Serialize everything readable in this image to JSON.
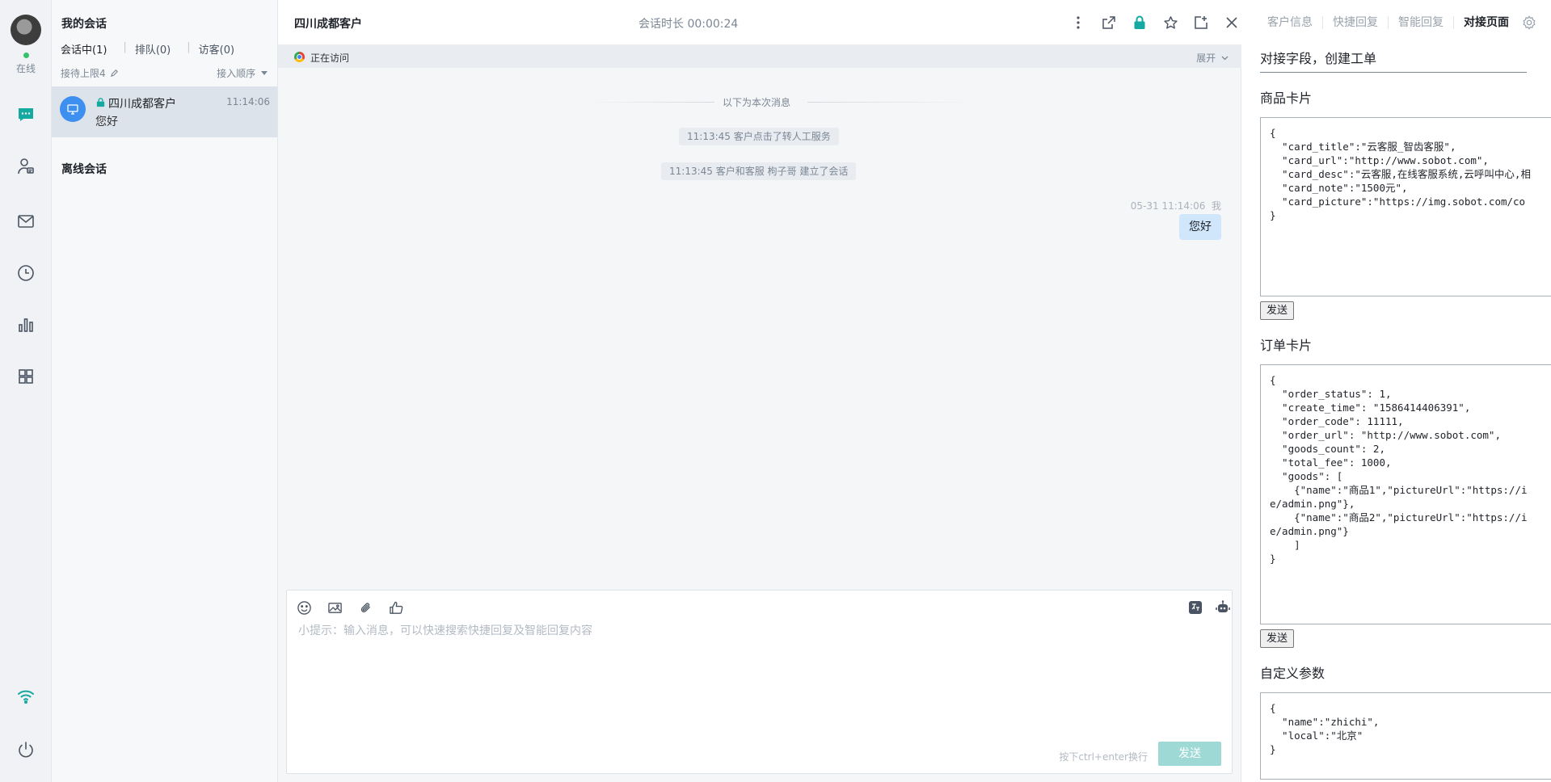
{
  "sidebar": {
    "status": "在线",
    "status_color": "#35c26b",
    "nav_icons": [
      "chat-icon",
      "visitor-icon",
      "mail-icon",
      "history-icon",
      "stats-icon",
      "apps-icon",
      "wifi-icon",
      "power-icon"
    ],
    "accent": "#14a9a1"
  },
  "conversations": {
    "title": "我的会话",
    "tabs": [
      {
        "label": "会话中(1)"
      },
      {
        "label": "排队(0)"
      },
      {
        "label": "访客(0)"
      }
    ],
    "limit": "接待上限4",
    "order": "接入顺序",
    "items": [
      {
        "name": "四川成都客户",
        "time": "11:14:06",
        "last_message": "您好"
      }
    ],
    "offline_title": "离线会话"
  },
  "chat": {
    "title": "四川成都客户",
    "duration": "会话时长 00:00:24",
    "visiting": "正在访问",
    "expand": "展开",
    "divider": "以下为本次消息",
    "system_messages": [
      "11:13:45 客户点击了转人工服务",
      "11:13:45 客户和客服 枸子哥 建立了会话"
    ],
    "message": {
      "meta": "05-31 11:14:06  我",
      "text": "您好"
    },
    "composer": {
      "placeholder": "小提示：输入消息，可以快速搜索快捷回复及智能回复内容",
      "hint": "按下ctrl+enter换行",
      "send": "发送",
      "send_color": "#9fd9d6"
    }
  },
  "right_panel": {
    "tabs": [
      {
        "label": "客户信息"
      },
      {
        "label": "快捷回复"
      },
      {
        "label": "智能回复"
      },
      {
        "label": "对接页面"
      }
    ],
    "heading": "对接字段，创建工单",
    "sections": [
      {
        "title": "商品卡片",
        "content": "{\n  \"card_title\":\"云客服_智齿客服\",\n  \"card_url\":\"http://www.sobot.com\",\n  \"card_desc\":\"云客服,在线客服系统,云呼叫中心,相\n  \"card_note\":\"1500元\",\n  \"card_picture\":\"https://img.sobot.com/co\n}",
        "button": "发送"
      },
      {
        "title": "订单卡片",
        "content": "{\n  \"order_status\": 1,\n  \"create_time\": \"1586414406391\",\n  \"order_code\": 11111,\n  \"order_url\": \"http://www.sobot.com\",\n  \"goods_count\": 2,\n  \"total_fee\": 1000,\n  \"goods\": [\n    {\"name\":\"商品1\",\"pictureUrl\":\"https://i\ne/admin.png\"},\n    {\"name\":\"商品2\",\"pictureUrl\":\"https://i\ne/admin.png\"}\n    ]\n}",
        "button": "发送"
      },
      {
        "title": "自定义参数",
        "content": "{\n  \"name\":\"zhichi\",\n  \"local\":\"北京\"\n}"
      }
    ]
  }
}
